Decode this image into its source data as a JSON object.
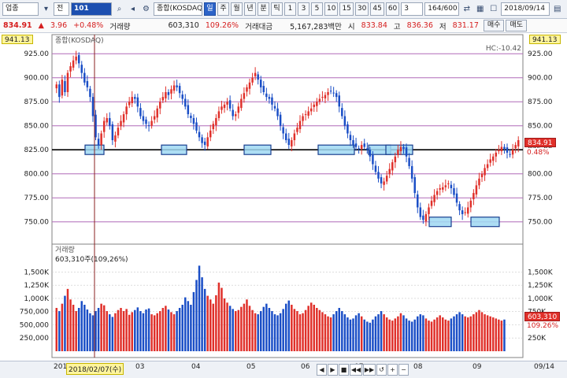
{
  "toolbar": {
    "market": "업종",
    "type": "전",
    "code": "101",
    "name": "종합(KOSDAQ)",
    "periods": [
      "일",
      "주",
      "월",
      "년",
      "분",
      "틱"
    ],
    "active_period": "일",
    "intervals": [
      "1",
      "3",
      "5",
      "10",
      "15",
      "30",
      "45",
      "60"
    ],
    "interval_value": "3",
    "count": "164/600",
    "date": "2018/09/14"
  },
  "quote": {
    "price": "834.91",
    "change": "3.96",
    "change_pct": "+0.48%",
    "volume_label": "거래량",
    "volume": "603,310",
    "volume_pct": "109.26%",
    "amount_label": "거래대금",
    "amount": "5,167,283백만",
    "open_label": "시",
    "open": "833.84",
    "high_label": "고",
    "high": "836.36",
    "low_label": "저",
    "low": "831.17",
    "buy_label": "매수",
    "sell_label": "매도"
  },
  "chart": {
    "top_price_left": "941.13",
    "top_price_right": "941.13",
    "price_legend": "종합(KOSDAQ)",
    "hc_label": "HC:-10.42",
    "current_price_tag": "834.91",
    "current_pct_tag": "0.48%",
    "volume_legend": "거래량",
    "volume_value": "603,310주(109,26%)",
    "current_volume_tag": "603,310",
    "current_volume_pct": "109.26%",
    "cursor_date": "2018/02/07(수)",
    "right_date": "09/14",
    "x_month_labels": [
      "201",
      "03",
      "04",
      "05",
      "06",
      "07",
      "08",
      "09"
    ]
  },
  "chart_data": {
    "type": "candlestick",
    "price_axis": {
      "ticks": [
        "925.00",
        "900.00",
        "875.00",
        "850.00",
        "825.00",
        "800.00",
        "775.00",
        "750.00"
      ],
      "ylim": [
        735,
        935
      ]
    },
    "volume_axis": {
      "left_ticks": [
        "1,500K",
        "1,250K",
        "1,000K",
        "750,000",
        "500,000",
        "250,000"
      ],
      "right_ticks": [
        "1,500K",
        "1,250K",
        "1,000K",
        "750K",
        "500K",
        "250K"
      ],
      "ylim": [
        0,
        1700
      ]
    },
    "support_level": 825,
    "highlight_zones": [
      825,
      825,
      825,
      825,
      825,
      825,
      750,
      750,
      825
    ],
    "closes": [
      893,
      880,
      898,
      885,
      905,
      912,
      918,
      922,
      915,
      905,
      895,
      890,
      880,
      860,
      838,
      830,
      842,
      855,
      858,
      850,
      835,
      840,
      848,
      855,
      862,
      870,
      875,
      880,
      878,
      870,
      860,
      855,
      852,
      850,
      855,
      860,
      868,
      875,
      880,
      885,
      882,
      888,
      892,
      890,
      884,
      878,
      870,
      862,
      858,
      852,
      845,
      838,
      832,
      830,
      838,
      845,
      852,
      858,
      865,
      870,
      872,
      875,
      868,
      860,
      862,
      870,
      878,
      884,
      890,
      895,
      900,
      905,
      898,
      890,
      885,
      880,
      878,
      872,
      868,
      860,
      850,
      842,
      835,
      830,
      835,
      842,
      848,
      855,
      860,
      862,
      865,
      868,
      872,
      875,
      878,
      880,
      882,
      885,
      886,
      884,
      880,
      870,
      860,
      850,
      842,
      835,
      830,
      828,
      826,
      830,
      828,
      825,
      818,
      810,
      802,
      795,
      790,
      792,
      798,
      805,
      812,
      818,
      825,
      828,
      826,
      818,
      808,
      795,
      780,
      765,
      755,
      752,
      758,
      765,
      772,
      778,
      782,
      785,
      786,
      788,
      790,
      785,
      778,
      770,
      762,
      758,
      760,
      765,
      772,
      780,
      788,
      795,
      800,
      806,
      810,
      815,
      818,
      822,
      825,
      828,
      826,
      822,
      820,
      825,
      830,
      835
    ],
    "volumes": [
      820,
      760,
      900,
      1050,
      1180,
      980,
      880,
      760,
      820,
      950,
      880,
      790,
      720,
      680,
      760,
      820,
      900,
      870,
      760,
      700,
      650,
      720,
      780,
      820,
      760,
      800,
      690,
      740,
      780,
      830,
      760,
      720,
      790,
      810,
      700,
      680,
      720,
      760,
      820,
      860,
      790,
      740,
      700,
      760,
      820,
      880,
      1020,
      950,
      880,
      1120,
      1350,
      1620,
      1400,
      1180,
      1050,
      980,
      900,
      1060,
      1300,
      1200,
      1000,
      920,
      860,
      800,
      760,
      780,
      840,
      900,
      980,
      860,
      780,
      720,
      700,
      760,
      840,
      900,
      820,
      760,
      700,
      680,
      720,
      800,
      900,
      960,
      880,
      800,
      760,
      700,
      720,
      780,
      860,
      920,
      880,
      820,
      780,
      740,
      700,
      660,
      640,
      700,
      760,
      820,
      760,
      700,
      640,
      600,
      620,
      680,
      720,
      660,
      600,
      560,
      540,
      600,
      660,
      700,
      760,
      700,
      640,
      600,
      580,
      620,
      660,
      720,
      680,
      620,
      580,
      560,
      600,
      660,
      700,
      680,
      620,
      580,
      560,
      600,
      640,
      680,
      640,
      600,
      580,
      620,
      660,
      700,
      740,
      700,
      660,
      640,
      660,
      700,
      740,
      780,
      740,
      700,
      680,
      660,
      640,
      620,
      600,
      580,
      600
    ]
  },
  "bottom": {
    "controls": [
      "◀",
      "▶",
      "■",
      "◀◀",
      "▶▶",
      "↺",
      "+",
      "−"
    ]
  },
  "colors": {
    "up": "#e0302a",
    "down": "#1a4ec6",
    "zone_fill": "#9fd8f2",
    "zone_stroke": "#1a3f8f",
    "grid": "#b06ab8"
  }
}
